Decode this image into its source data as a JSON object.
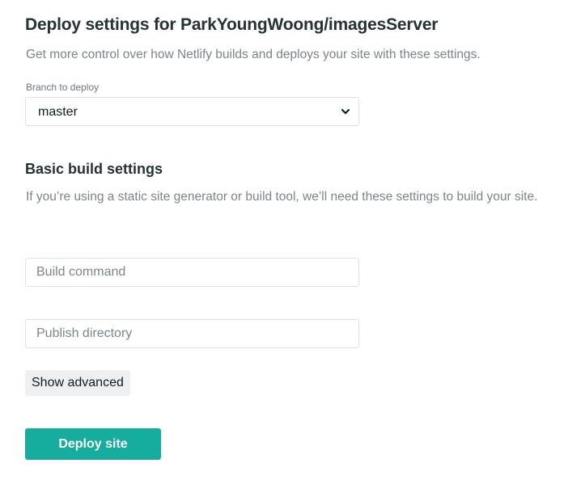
{
  "deploy": {
    "title": "Deploy settings for ParkYoungWoong/imagesServer",
    "subtitle": "Get more control over how Netlify builds and deploys your site with these settings."
  },
  "branch": {
    "label": "Branch to deploy",
    "selected": "master",
    "icon": "chevron-down-icon"
  },
  "build": {
    "title": "Basic build settings",
    "description": "If you’re using a static site generator or build tool, we’ll need these settings to build your site.",
    "command_placeholder": "Build command",
    "command_value": "",
    "publish_placeholder": "Publish directory",
    "publish_value": ""
  },
  "actions": {
    "show_advanced_label": "Show advanced",
    "deploy_label": "Deploy site"
  },
  "colors": {
    "accent": "#16ad9f",
    "heading": "#253238",
    "muted_text": "#7d8589",
    "border": "#dfe2e3"
  }
}
